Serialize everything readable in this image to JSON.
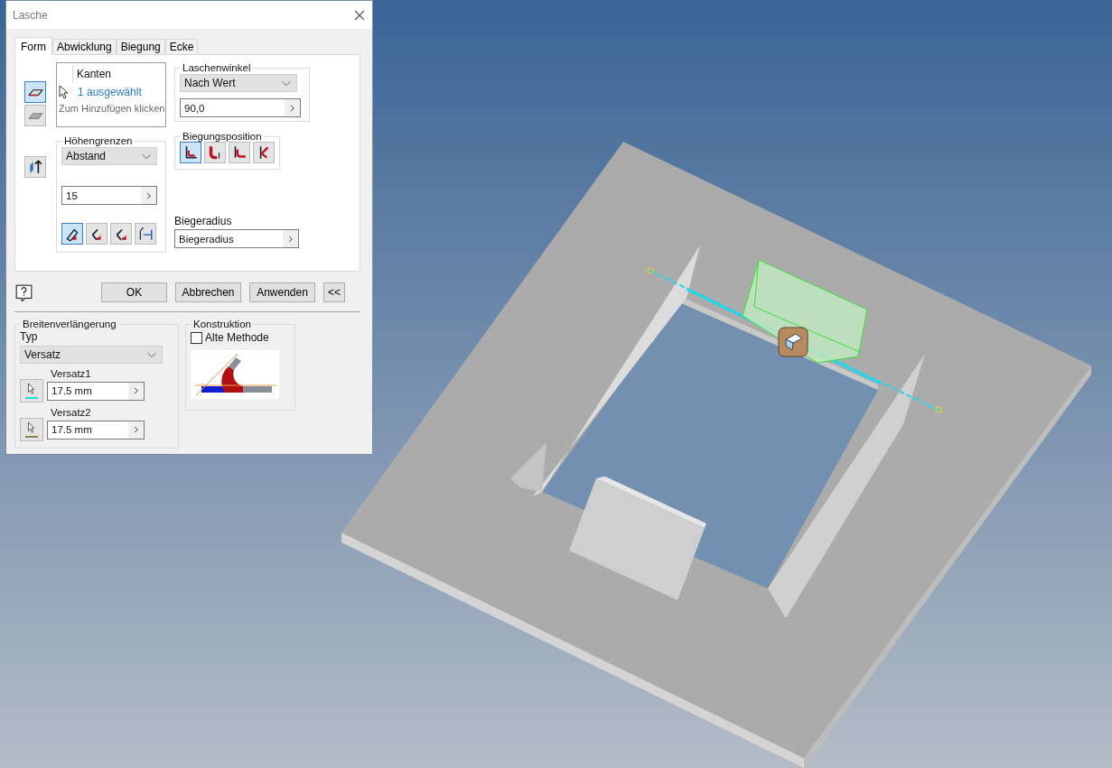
{
  "window": {
    "title": "Lasche"
  },
  "tabs": [
    {
      "label": "Form",
      "selected": true
    },
    {
      "label": "Abwicklung",
      "selected": false
    },
    {
      "label": "Biegung",
      "selected": false
    },
    {
      "label": "Ecke",
      "selected": false
    }
  ],
  "side_buttons": [
    {
      "selected": true
    },
    {
      "selected": false
    }
  ],
  "flip_button": {
    "selected": false
  },
  "edges": {
    "header": "Kanten",
    "selection": "1 ausgewählt",
    "hint": "Zum Hinzufügen klicken"
  },
  "flange_angle": {
    "label": "Laschenwinkel",
    "mode": "Nach Wert",
    "value": "90,0"
  },
  "height_extents": {
    "label": "Höhengrenzen",
    "mode": "Abstand",
    "value": "15",
    "options": [
      {
        "selected": true
      },
      {
        "selected": false
      },
      {
        "selected": false
      },
      {
        "selected": false
      }
    ]
  },
  "bend_position": {
    "label": "Biegungsposition",
    "options": [
      {
        "selected": true
      },
      {
        "selected": false
      },
      {
        "selected": false
      },
      {
        "selected": false
      }
    ]
  },
  "bend_radius": {
    "label": "Biegeradius",
    "value": "Biegeradius"
  },
  "buttons": [
    {
      "label": "OK"
    },
    {
      "label": "Abbrechen"
    },
    {
      "label": "Anwenden"
    },
    {
      "label": "<<"
    }
  ],
  "width_extents": {
    "label": "Breitenverlängerung",
    "type_label": "Typ",
    "type": "Versatz",
    "offsets": [
      {
        "label": "Versatz1",
        "value": "17.5 mm",
        "color": "#22d8e8"
      },
      {
        "label": "Versatz2",
        "value": "17.5 mm",
        "color": "#8a8050"
      }
    ]
  },
  "construction": {
    "label": "Konstruktion",
    "option": {
      "label": "Alte Methode",
      "checked": false
    }
  }
}
